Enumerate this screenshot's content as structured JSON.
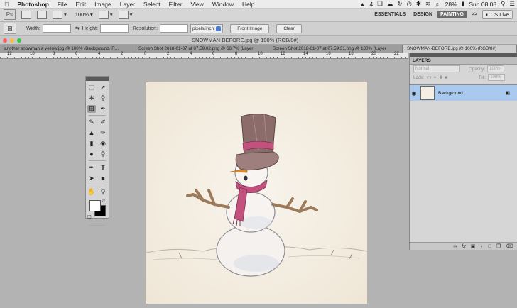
{
  "menubar": {
    "app": "Photoshop",
    "items": [
      "File",
      "Edit",
      "Image",
      "Layer",
      "Select",
      "Filter",
      "View",
      "Window",
      "Help"
    ],
    "status": {
      "adobe_count": "4",
      "battery": "28%",
      "clock": "Sun 08:08"
    }
  },
  "appbar": {
    "logo": "Ps",
    "zoom": "100%",
    "workspaces": [
      "ESSENTIALS",
      "DESIGN",
      "PAINTING"
    ],
    "active_workspace": "PAINTING",
    "more": ">>",
    "cs_live": "CS Live"
  },
  "options": {
    "width_label": "Width:",
    "height_label": "Height:",
    "resolution_label": "Resolution:",
    "units": "pixels/inch",
    "front_image": "Front Image",
    "clear": "Clear"
  },
  "document": {
    "title": "SNOWMAN-BEFORE.jpg @ 100% (RGB/8#)"
  },
  "tabs": [
    "another snowman a yellow.jpg @ 100% (Background, R...",
    "Screen Shot 2018-01-07 at 07.59.02.png @ 66.7% (Layer",
    "Screen Shot 2018-01-07 at 07.59.31.png @ 100% (Layer",
    "SNOWMAN-BEFORE.jpg @ 100% (RGB/8#)"
  ],
  "ruler": [
    "12",
    "10",
    "8",
    "6",
    "4",
    "2",
    "0",
    "2",
    "4",
    "6",
    "8",
    "10",
    "12",
    "14",
    "16",
    "18",
    "20",
    "22"
  ],
  "layers": {
    "title": "LAYERS",
    "blend_mode": "Normal",
    "opacity_label": "Opacity:",
    "opacity_value": "100%",
    "lock_label": "Lock:",
    "fill_label": "Fill:",
    "fill_value": "100%",
    "layer_name": "Background"
  },
  "colors": {
    "selected_layer": "#a9c9ef",
    "canvas_paper": "#f3ede2"
  }
}
